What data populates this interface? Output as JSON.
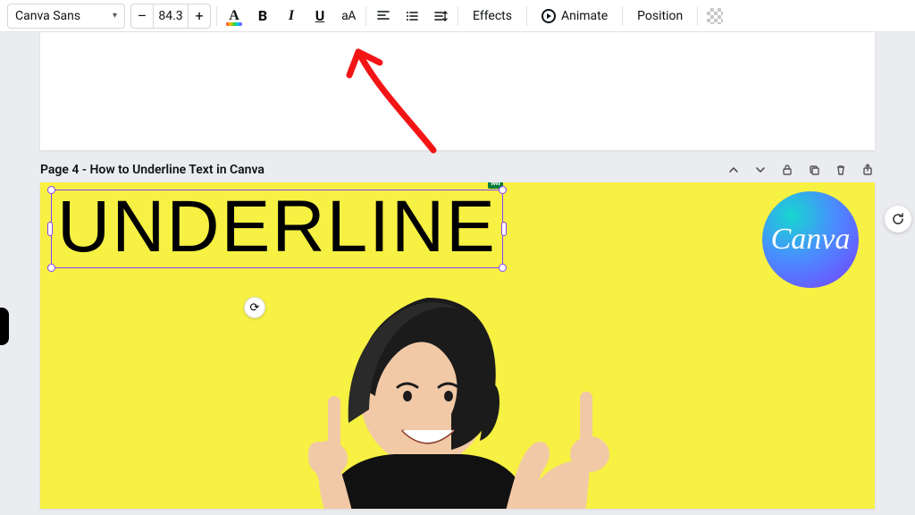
{
  "toolbar": {
    "font_name": "Canva Sans",
    "font_size": "84.3",
    "minus": "–",
    "plus": "+",
    "text_color_glyph": "A",
    "bold_glyph": "B",
    "italic_glyph": "I",
    "underline_glyph": "U",
    "case_glyph": "aA",
    "effects_label": "Effects",
    "animate_label": "Animate",
    "position_label": "Position"
  },
  "page_header": {
    "title": "Page 4 - How to Underline Text in Canva"
  },
  "canvas": {
    "text": "UNDERLINE",
    "badge": "MI",
    "logo_text": "Canva",
    "rotate_glyph": "⟳",
    "refresh_glyph": "↻"
  }
}
